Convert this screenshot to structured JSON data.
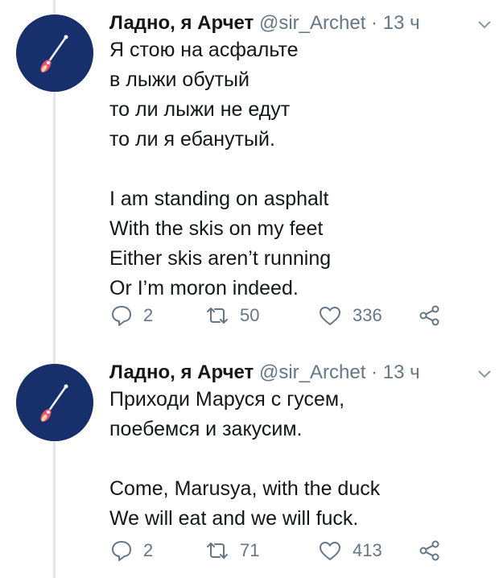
{
  "accent_color": "#1da1f2",
  "thread": [
    {
      "author_name": "Ладно, я Арчет",
      "handle": "@sir_Archet",
      "separator": "·",
      "time": "13 ч",
      "avatar_icon": "rocket-icon",
      "paragraphs": [
        [
          "Я стою на асфальте",
          "в лыжи обутый",
          "то ли лыжи не едут",
          "то ли я ебанутый."
        ],
        [
          "I am standing on asphalt",
          "With the skis on my feet",
          "Either skis aren’t running",
          "Or I’m moron indeed."
        ]
      ],
      "replies": "2",
      "retweets": "50",
      "likes": "336"
    },
    {
      "author_name": "Ладно, я Арчет",
      "handle": "@sir_Archet",
      "separator": "·",
      "time": "13 ч",
      "avatar_icon": "rocket-icon",
      "paragraphs": [
        [
          "Приходи Маруся с гусем,",
          "поебемся и закусим."
        ],
        [
          "Come, Marusya, with the duck",
          "We will eat and we will fuck."
        ]
      ],
      "replies": "2",
      "retweets": "71",
      "likes": "413"
    }
  ]
}
